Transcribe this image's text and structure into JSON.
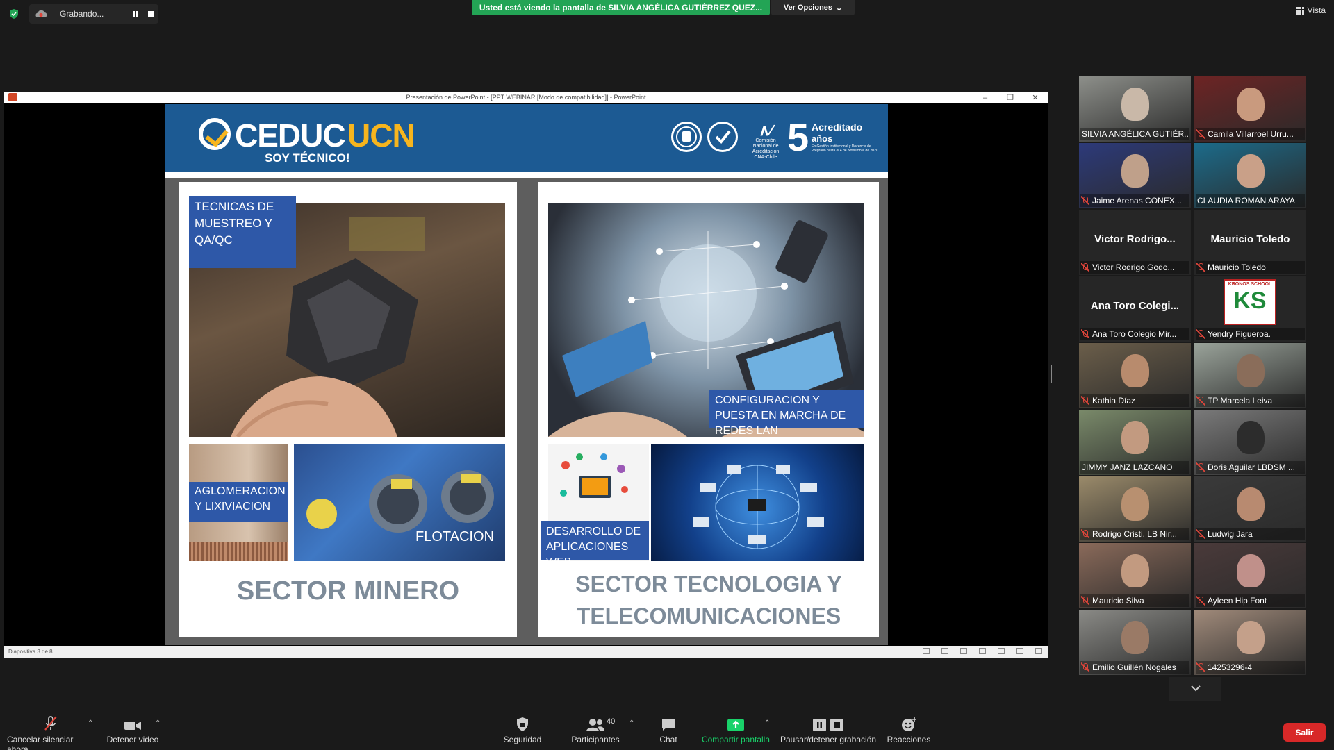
{
  "top": {
    "recording_label": "Grabando...",
    "share_banner": "Usted está viendo la pantalla de SILVIA ANGÉLICA GUTIÉRREZ QUEZ...",
    "view_options": "Ver Opciones",
    "view_label": "Vista"
  },
  "ppt": {
    "window_title": "Presentación de PowerPoint - [PPT WEBINAR [Modo de compatibilidad]] - PowerPoint",
    "status_text": "Diapositiva 3 de 8"
  },
  "slide": {
    "brand_ceduc": "CEDUC",
    "brand_ucn": "UCN",
    "brand_tag": "SOY TÉCNICO!",
    "accr_number": "5",
    "accr_title": "Acreditado",
    "accr_years": "años",
    "accr_detail": "En Gestión Institucional y Docencia de Pregrado hasta el 4 de Noviembre de 2020",
    "cna_text": "Comisión Nacional de Acreditación CNA-Chile",
    "left_label_main": "TECNICAS DE MUESTREO Y QA/QC",
    "left_label_aglo": "AGLOMERACION Y LIXIVIACION",
    "left_label_flot": "FLOTACION",
    "left_sector": "SECTOR MINERO",
    "right_label_main": "CONFIGURACION Y PUESTA EN MARCHA DE REDES LAN",
    "right_label_web": "DESARROLLO DE APLICACIONES WEB",
    "right_sector_l1": "SECTOR TECNOLOGIA Y",
    "right_sector_l2": "TELECOMUNICACIONES"
  },
  "participants": [
    {
      "name": "SILVIA ANGÉLICA GUTIÉR...",
      "kind": "video",
      "active": true,
      "muted": false
    },
    {
      "name": "Camila Villarroel Urru...",
      "kind": "video",
      "muted": true
    },
    {
      "name": "Jaime Arenas CONEX...",
      "kind": "video",
      "muted": true
    },
    {
      "name": "CLAUDIA ROMAN ARAYA",
      "kind": "video",
      "muted": false
    },
    {
      "name": "Victor Rodrigo Godo...",
      "big": "Victor  Rodrigo...",
      "kind": "name",
      "muted": true
    },
    {
      "name": "Mauricio Toledo",
      "big": "Mauricio Toledo",
      "kind": "name",
      "muted": true
    },
    {
      "name": "Ana Toro Colegio Mir...",
      "big": "Ana Toro Colegi...",
      "kind": "name",
      "muted": true
    },
    {
      "name": "Yendry Figueroa.",
      "kind": "logo",
      "logo": "KRONOS SCHOOL",
      "muted": true
    },
    {
      "name": "Kathia Díaz",
      "kind": "video",
      "muted": true
    },
    {
      "name": "TP Marcela Leiva",
      "kind": "video",
      "muted": true
    },
    {
      "name": "JIMMY JANZ LAZCANO",
      "kind": "video",
      "muted": false
    },
    {
      "name": "Doris Aguilar LBDSM ...",
      "kind": "video",
      "muted": true
    },
    {
      "name": "Rodrigo Cristi. LB Nir...",
      "kind": "video",
      "muted": true
    },
    {
      "name": "Ludwig Jara",
      "kind": "video",
      "muted": true
    },
    {
      "name": "Mauricio Silva",
      "kind": "video",
      "muted": true
    },
    {
      "name": "Ayleen Hip Font",
      "kind": "video",
      "muted": true
    },
    {
      "name": "Emilio Guillén Nogales",
      "kind": "video",
      "muted": true
    },
    {
      "name": "14253296-4",
      "kind": "video",
      "muted": true
    }
  ],
  "toolbar": {
    "mute_label": "Cancelar silenciar ahora",
    "video_label": "Detener video",
    "security_label": "Seguridad",
    "participants_label": "Participantes",
    "participants_count": "40",
    "chat_label": "Chat",
    "share_label": "Compartir pantalla",
    "record_label": "Pausar/detener grabación",
    "reactions_label": "Reacciones",
    "leave_label": "Salir"
  },
  "colors": {
    "banner_green": "#23a455",
    "share_green": "#19d26a",
    "leave_red": "#d82828",
    "active_speaker": "#c7e34b",
    "slide_blue": "#1c5a93",
    "label_blue": "#2e58a8"
  }
}
